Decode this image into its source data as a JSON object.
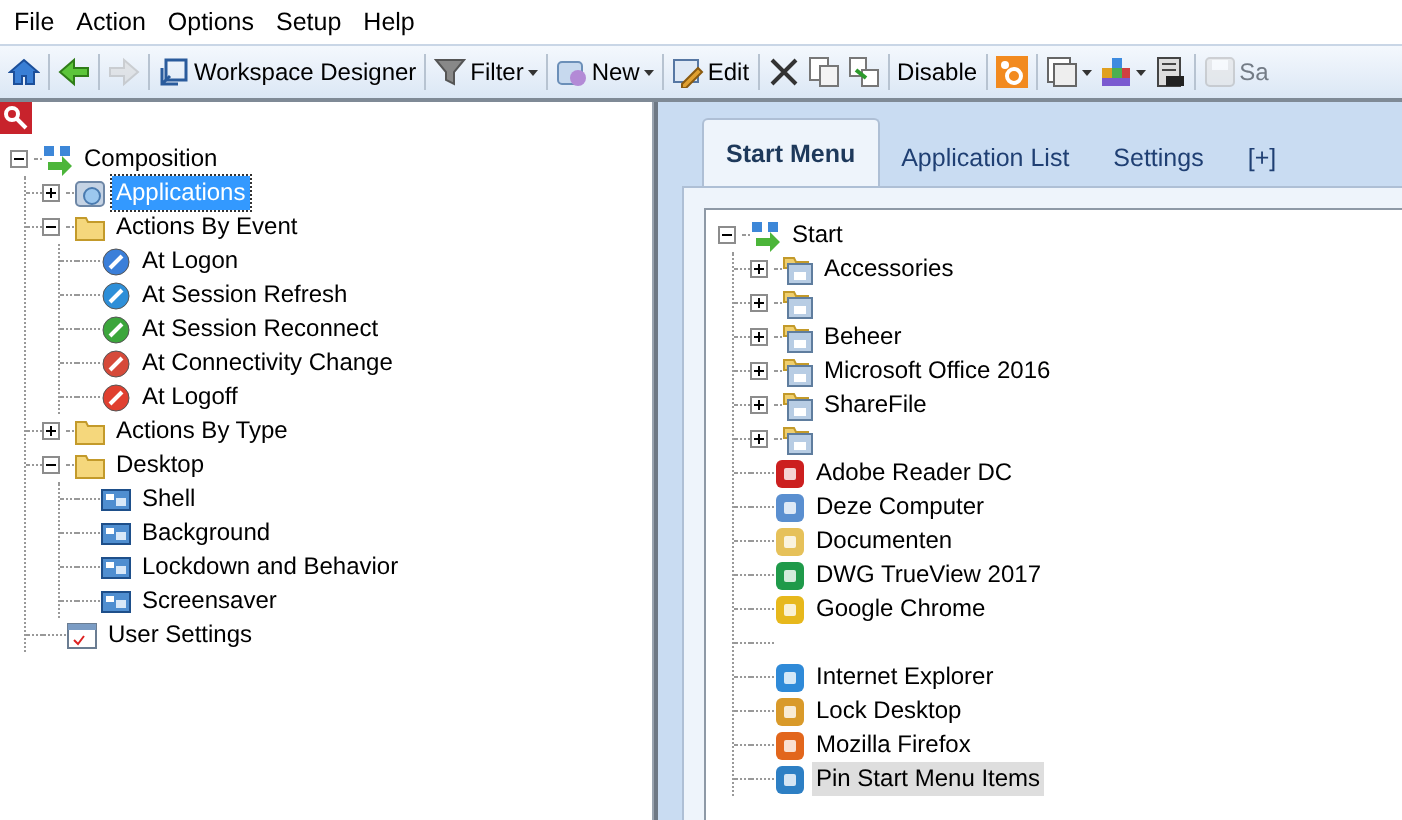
{
  "menu": [
    "File",
    "Action",
    "Options",
    "Setup",
    "Help"
  ],
  "toolbar": [
    {
      "kind": "icon",
      "disabled": false
    },
    {
      "kind": "separator"
    },
    {
      "kind": "icon",
      "disabled": false
    },
    {
      "kind": "separator"
    },
    {
      "kind": "icon",
      "disabled": true
    },
    {
      "kind": "separator"
    },
    {
      "kind": "button",
      "label": "Workspace Designer",
      "disabled": false
    },
    {
      "kind": "separator"
    },
    {
      "kind": "dropdown",
      "label": "Filter",
      "disabled": false
    },
    {
      "kind": "separator"
    },
    {
      "kind": "dropdown",
      "label": "New",
      "disabled": false
    },
    {
      "kind": "separator"
    },
    {
      "kind": "button",
      "label": "Edit",
      "disabled": false
    },
    {
      "kind": "separator"
    },
    {
      "kind": "icon",
      "disabled": false
    },
    {
      "kind": "icon",
      "disabled": false
    },
    {
      "kind": "icon",
      "disabled": false
    },
    {
      "kind": "separator"
    },
    {
      "kind": "text",
      "label": "Disable",
      "disabled": false
    },
    {
      "kind": "separator"
    },
    {
      "kind": "icon",
      "disabled": false
    },
    {
      "kind": "separator"
    },
    {
      "kind": "dropdown",
      "disabled": false
    },
    {
      "kind": "dropdown",
      "disabled": false
    },
    {
      "kind": "icon",
      "disabled": false
    },
    {
      "kind": "separator"
    },
    {
      "kind": "button",
      "label": "Sa",
      "disabled": true
    }
  ],
  "left_tree": {
    "items": [
      {
        "label": "Composition",
        "kind": "root",
        "expanded": true,
        "selected": false,
        "children": [
          {
            "label": "Applications",
            "kind": "module",
            "expanded": false,
            "selected": true
          },
          {
            "label": "Actions By Event",
            "kind": "folder",
            "expanded": true,
            "selected": false,
            "children": [
              {
                "label": "At Logon",
                "kind": "event",
                "selected": false
              },
              {
                "label": "At Session Refresh",
                "kind": "event",
                "selected": false
              },
              {
                "label": "At Session Reconnect",
                "kind": "event",
                "selected": false
              },
              {
                "label": "At Connectivity Change",
                "kind": "event",
                "selected": false
              },
              {
                "label": "At Logoff",
                "kind": "event",
                "selected": false
              }
            ]
          },
          {
            "label": "Actions By Type",
            "kind": "folder",
            "expanded": false,
            "selected": false
          },
          {
            "label": "Desktop",
            "kind": "folder",
            "expanded": true,
            "selected": false,
            "children": [
              {
                "label": "Shell",
                "kind": "setting",
                "selected": false
              },
              {
                "label": "Background",
                "kind": "setting",
                "selected": false
              },
              {
                "label": "Lockdown and Behavior",
                "kind": "setting",
                "selected": false
              },
              {
                "label": "Screensaver",
                "kind": "setting",
                "selected": false
              }
            ]
          },
          {
            "label": "User Settings",
            "kind": "page",
            "selected": false
          }
        ]
      }
    ]
  },
  "tabs": [
    {
      "label": "Start Menu",
      "selected": true
    },
    {
      "label": "Application List",
      "selected": false
    },
    {
      "label": "Settings",
      "selected": false
    },
    {
      "label": "[+]",
      "selected": false
    }
  ],
  "start_tree": {
    "items": [
      {
        "label": "Start",
        "kind": "root",
        "expanded": true,
        "selected": false,
        "children": [
          {
            "label": "Accessories",
            "kind": "group",
            "expanded": false,
            "selected": false
          },
          {
            "kind": "group",
            "expanded": false,
            "selected": false
          },
          {
            "label": "Beheer",
            "kind": "group",
            "expanded": false,
            "selected": false
          },
          {
            "label": "Microsoft Office 2016",
            "kind": "group",
            "expanded": false,
            "selected": false
          },
          {
            "label": "ShareFile",
            "kind": "group",
            "expanded": false,
            "selected": false
          },
          {
            "kind": "group",
            "expanded": false,
            "selected": false
          },
          {
            "label": "Adobe Reader DC",
            "kind": "shortcut",
            "selected": false
          },
          {
            "label": "Deze Computer",
            "kind": "shortcut",
            "selected": false
          },
          {
            "label": "Documenten",
            "kind": "shortcut",
            "selected": false
          },
          {
            "label": "DWG TrueView 2017",
            "kind": "shortcut",
            "selected": false
          },
          {
            "label": "Google Chrome",
            "kind": "shortcut",
            "selected": false
          },
          {
            "kind": "separator",
            "selected": false
          },
          {
            "label": "Internet Explorer",
            "kind": "shortcut",
            "selected": false
          },
          {
            "label": "Lock Desktop",
            "kind": "shortcut",
            "selected": false
          },
          {
            "label": "Mozilla Firefox",
            "kind": "shortcut",
            "selected": false
          },
          {
            "label": "Pin Start Menu Items",
            "kind": "shortcut",
            "selected": true
          }
        ]
      }
    ]
  }
}
